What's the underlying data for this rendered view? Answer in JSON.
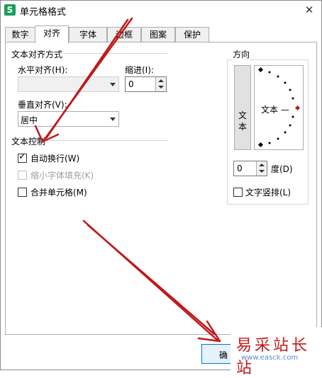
{
  "window": {
    "title": "单元格格式",
    "close_symbol": "✕",
    "app_icon_letter": "S"
  },
  "tabs": [
    {
      "label": "数字",
      "active": false
    },
    {
      "label": "对齐",
      "active": true
    },
    {
      "label": "字体",
      "active": false
    },
    {
      "label": "边框",
      "active": false
    },
    {
      "label": "图案",
      "active": false
    },
    {
      "label": "保护",
      "active": false
    }
  ],
  "alignment": {
    "group_title": "文本对齐方式",
    "horizontal_label": "水平对齐(H):",
    "horizontal_value": "",
    "indent_label": "缩进(I):",
    "indent_value": "0",
    "vertical_label": "垂直对齐(V):",
    "vertical_value": "居中"
  },
  "text_control": {
    "group_title": "文本控制",
    "wrap_text": {
      "label": "自动换行(W)",
      "checked": true
    },
    "shrink_to_fit": {
      "label": "缩小字体填充(K)",
      "checked": false,
      "disabled": true
    },
    "merge_cells": {
      "label": "合并单元格(M)",
      "checked": false
    }
  },
  "orientation": {
    "group_title": "方向",
    "vertical_text": "文本",
    "dial_text": "文本 —",
    "degree_value": "0",
    "degree_label": "度(D)",
    "vertical_text_checkbox": {
      "label": "文字竖排(L)",
      "checked": false
    }
  },
  "buttons": {
    "ok_label": "确"
  },
  "watermark": {
    "text": "易采站长站",
    "url": "www.easck.com"
  },
  "colors": {
    "arrow": "#c0191b",
    "dial_marker": "#c0191b",
    "watermark_text": "#c21a1a",
    "ok_border": "#0078d7"
  }
}
